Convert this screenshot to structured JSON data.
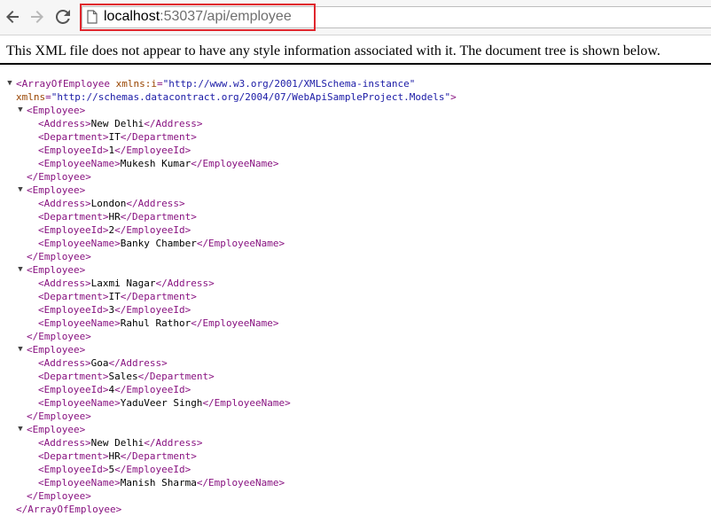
{
  "browser": {
    "url_host": "localhost",
    "url_rest": ":53037/api/employee"
  },
  "info_message": "This XML file does not appear to have any style information associated with it. The document tree is shown below.",
  "xml": {
    "root_open": "<ArrayOfEmployee",
    "root_attr1_name": "xmlns:i",
    "root_attr1_value": "\"http://www.w3.org/2001/XMLSchema-instance\"",
    "root_attr2_name": "xmlns",
    "root_attr2_value": "\"http://schemas.datacontract.org/2004/07/WebApiSampleProject.Models\"",
    "root_close": "</ArrayOfEmployee>",
    "employee_open": "<Employee>",
    "employee_close": "</Employee>",
    "employees": [
      {
        "Address": "New Delhi",
        "Department": "IT",
        "EmployeeId": "1",
        "EmployeeName": "Mukesh Kumar"
      },
      {
        "Address": "London",
        "Department": "HR",
        "EmployeeId": "2",
        "EmployeeName": "Banky Chamber"
      },
      {
        "Address": "Laxmi Nagar",
        "Department": "IT",
        "EmployeeId": "3",
        "EmployeeName": "Rahul Rathor"
      },
      {
        "Address": "Goa",
        "Department": "Sales",
        "EmployeeId": "4",
        "EmployeeName": "YaduVeer Singh"
      },
      {
        "Address": "New Delhi",
        "Department": "HR",
        "EmployeeId": "5",
        "EmployeeName": "Manish Sharma"
      }
    ]
  },
  "icons": {
    "back": "arrow-left",
    "forward": "arrow-right",
    "reload": "reload",
    "page": "page",
    "collapse": "triangle-down"
  }
}
